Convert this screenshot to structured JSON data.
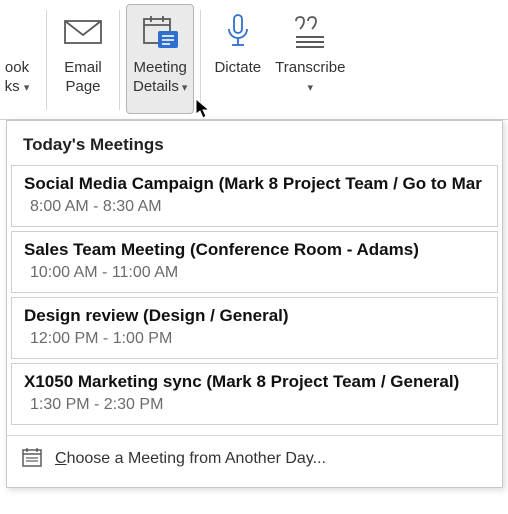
{
  "ribbon": {
    "items": [
      {
        "label": "ook\nks",
        "icon": "chevron-down-icon",
        "has_chev": true
      },
      {
        "label": "Email\nPage",
        "icon": "envelope-icon",
        "has_chev": false
      },
      {
        "label": "Meeting\nDetails",
        "icon": "calendar-details-icon",
        "has_chev": true,
        "active": true
      },
      {
        "label": "Dictate",
        "icon": "microphone-icon",
        "has_chev": false
      },
      {
        "label": "Transcribe",
        "icon": "transcribe-icon",
        "has_chev": true
      }
    ]
  },
  "dropdown": {
    "header": "Today's Meetings",
    "meetings": [
      {
        "title": "Social Media Campaign (Mark 8 Project Team / Go to Mar",
        "time": "8:00 AM - 8:30 AM"
      },
      {
        "title": "Sales Team Meeting (Conference Room - Adams)",
        "time": "10:00 AM - 11:00 AM"
      },
      {
        "title": "Design review (Design / General)",
        "time": "12:00 PM - 1:00 PM"
      },
      {
        "title": "X1050 Marketing sync (Mark 8 Project Team / General)",
        "time": "1:30 PM - 2:30 PM"
      }
    ],
    "footer_prefix": "C",
    "footer_rest": "hoose a Meeting from Another Day..."
  }
}
